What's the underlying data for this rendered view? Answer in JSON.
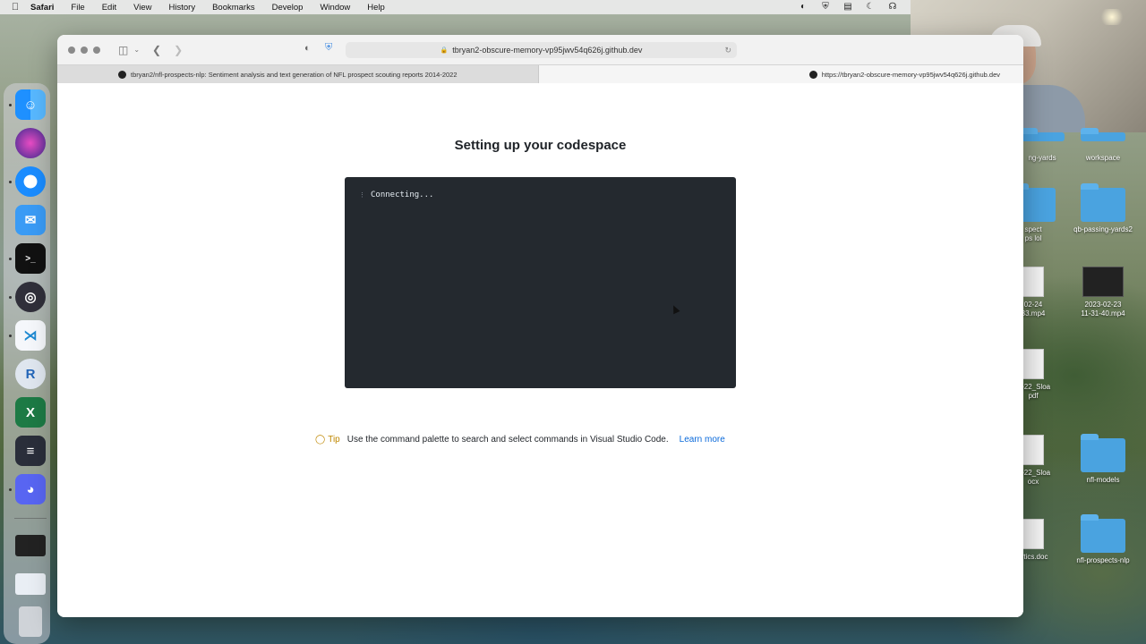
{
  "menubar": {
    "app_name": "Safari",
    "items": [
      "File",
      "Edit",
      "View",
      "History",
      "Bookmarks",
      "Develop",
      "Window",
      "Help"
    ],
    "status_icons": [
      "screen-mirror-icon",
      "shield-check-icon",
      "notes-icon",
      "moon-icon",
      "headphones-icon"
    ]
  },
  "safari": {
    "address": "tbryan2-obscure-memory-vp95jwv54q626j.github.dev",
    "tabs": [
      {
        "label": "tbryan2/nfl-prospects-nlp: Sentiment analysis and text generation of NFL prospect scouting reports 2014-2022",
        "active": false
      },
      {
        "label": "https://tbryan2-obscure-memory-vp95jwv54q626j.github.dev",
        "active": true
      }
    ]
  },
  "page": {
    "title": "Setting up your codespace",
    "terminal_text": "Connecting...",
    "tip_label": "Tip",
    "tip_text": "Use the command palette to search and select commands in Visual Studio Code.",
    "learn_more": "Learn more"
  },
  "desktop": {
    "items": [
      {
        "label": "ng-yards",
        "kind": "folder"
      },
      {
        "label": "workspace",
        "kind": "folder"
      },
      {
        "label": "spect\nps lol",
        "kind": "folder"
      },
      {
        "label": "qb-passing-yards2",
        "kind": "folder"
      },
      {
        "label": "02-24\n33.mp4",
        "kind": "video"
      },
      {
        "label": "2023-02-23\n11-31-40.mp4",
        "kind": "video"
      },
      {
        "label": "ne22_Sloa\npdf",
        "kind": "doc"
      },
      {
        "label": "ne22_Sloa\nocx",
        "kind": "doc"
      },
      {
        "label": "nfl-models",
        "kind": "folder"
      },
      {
        "label": "lytics.doc",
        "kind": "doc"
      },
      {
        "label": "nfl-prospects-nlp",
        "kind": "folder"
      }
    ]
  },
  "dock": {
    "apps": [
      "Finder",
      "Siri",
      "Safari",
      "Mail",
      "Terminal",
      "OBS",
      "VS Code",
      "R",
      "Excel",
      "Slack",
      "Discord"
    ]
  },
  "colors": {
    "terminal_bg": "#24292f",
    "link": "#0969da",
    "tip": "#bf8700"
  }
}
